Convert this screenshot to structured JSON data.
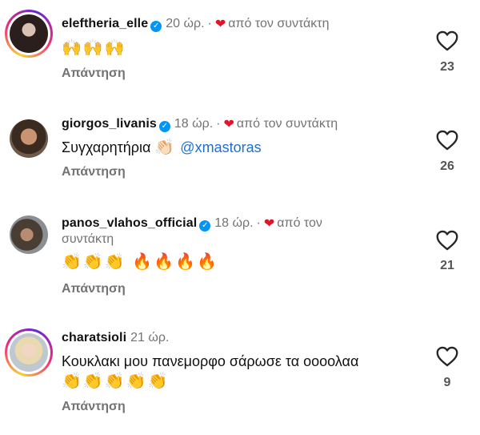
{
  "comments": [
    {
      "username": "eleftheria_elle",
      "verified": true,
      "time": "20 ώρ.",
      "separator": "·",
      "author_like": "από τον συντάκτη",
      "text": "",
      "emoji": "🙌🙌🙌",
      "reply_label": "Απάντηση",
      "likes": "23"
    },
    {
      "username": "giorgos_livanis",
      "verified": true,
      "time": "18 ώρ.",
      "separator": "·",
      "author_like": "από τον συντάκτη",
      "text": "Συγχαρητήρια",
      "emoji": "👏🏻",
      "mention": "@xmastoras",
      "reply_label": "Απάντηση",
      "likes": "26"
    },
    {
      "username": "panos_vlahos_official",
      "verified": true,
      "time": "18 ώρ.",
      "separator": "·",
      "author_like_line1": "από τον",
      "author_like_line2": "συντάκτη",
      "emoji": "👏👏👏 🔥🔥🔥🔥",
      "reply_label": "Απάντηση",
      "likes": "21"
    },
    {
      "username": "charatsioli",
      "verified": false,
      "time": "21 ώρ.",
      "text": "Κουκλακι μου πανεμορφο σάρωσε τα οοοολαα",
      "emoji": "👏👏👏👏👏",
      "reply_label": "Απάντηση",
      "likes": "9"
    }
  ],
  "colors": {
    "author_heart": "#e0152b",
    "verified_badge": "#0095f6",
    "mention": "#1d6fd6",
    "muted_text": "#737373"
  },
  "icons": {
    "verified": "verified-badge-icon",
    "author_heart": "heart-filled-icon",
    "like": "heart-outline-icon"
  }
}
